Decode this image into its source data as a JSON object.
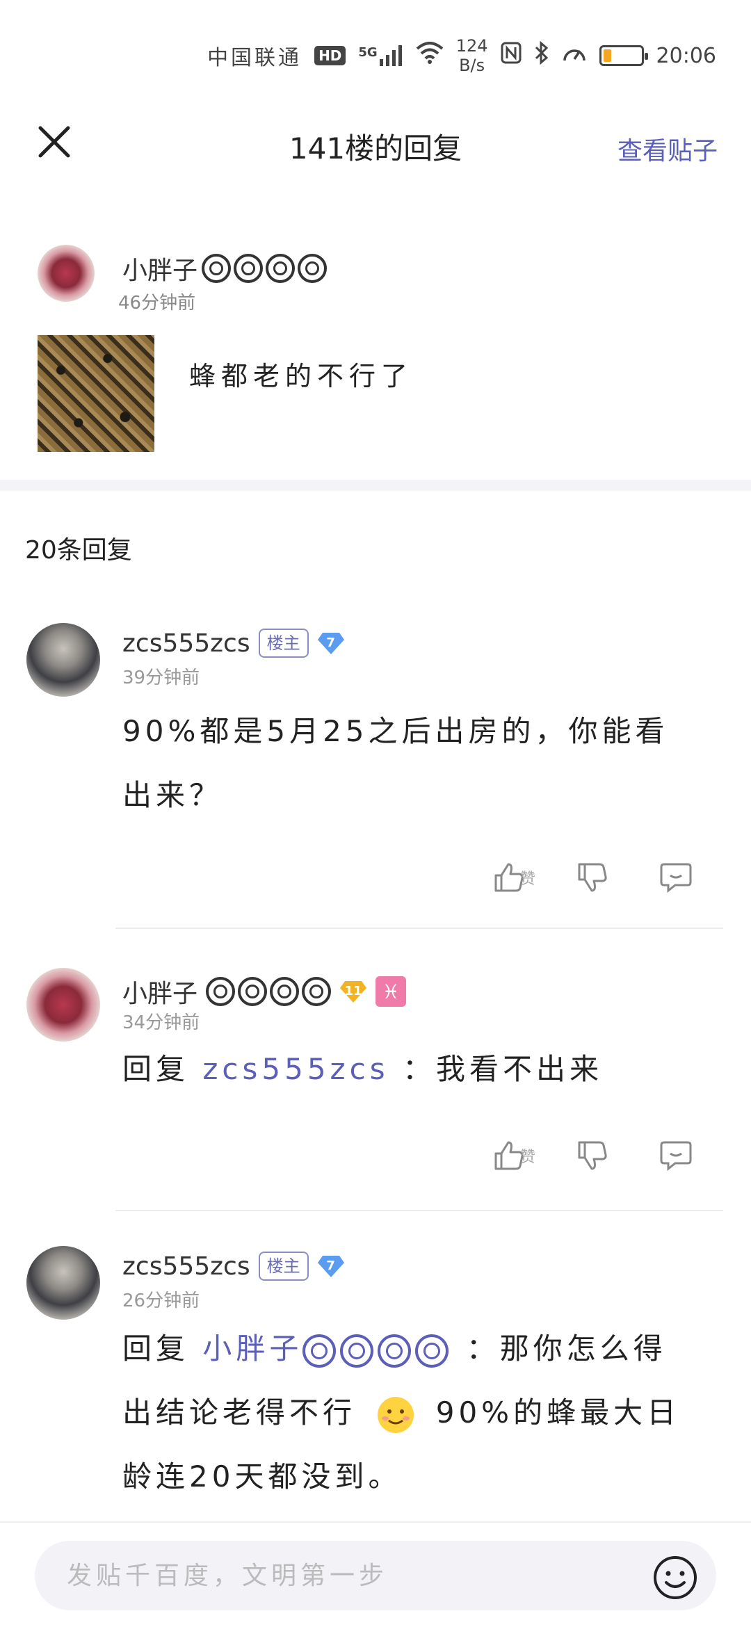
{
  "status_bar": {
    "carrier": "中国联通",
    "hd": "HD",
    "network": "5G",
    "speed_value": "124",
    "speed_unit": "B/s",
    "battery_level": 0.3,
    "time": "20:06"
  },
  "header": {
    "title": "141楼的回复",
    "view_post": "查看贴子"
  },
  "original_post": {
    "author": "小胖子",
    "time": "46分钟前",
    "text": "蜂都老的不行了"
  },
  "reply_count": "20条回复",
  "replies": [
    {
      "author": "zcs555zcs",
      "owner_badge": "楼主",
      "level": "7",
      "time": "39分钟前",
      "body": "90%都是5月25之后出房的，你能看出来？",
      "like_label": "赞"
    },
    {
      "author": "小胖子",
      "level": "11",
      "time": "34分钟前",
      "prefix": "回复",
      "mention": "zcs555zcs",
      "body": "：我看不出来",
      "like_label": "赞"
    },
    {
      "author": "zcs555zcs",
      "owner_badge": "楼主",
      "level": "7",
      "time": "26分钟前",
      "prefix": "回复",
      "mention": "小胖子",
      "body_part1": "：那你怎么得出结论老得不行",
      "body_part2": "90%的蜂最大日龄连20天都没到。"
    }
  ],
  "bottom_bar": {
    "placeholder": "发贴千百度，文明第一步"
  },
  "colors": {
    "accent": "#5b5fb8",
    "level_blue": "#5b9cf0",
    "level_gold": "#f2b322",
    "pisces": "#f07aa8"
  }
}
